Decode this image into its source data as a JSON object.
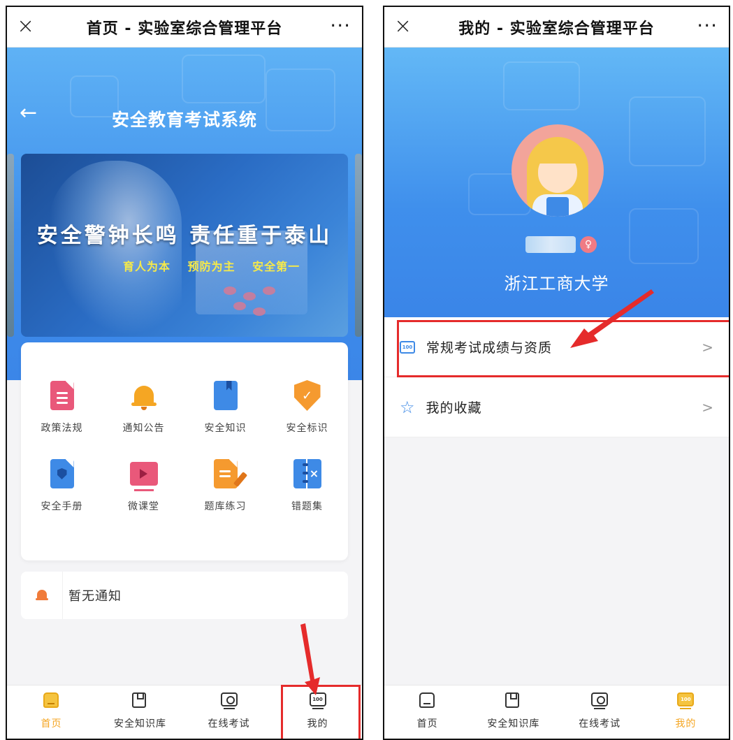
{
  "left_screen": {
    "titlebar": {
      "close": "×",
      "title": "首页 - 实验室综合管理平台",
      "more": "···"
    },
    "hero": {
      "back": "←",
      "title": "安全教育考试系统"
    },
    "banner": {
      "slogan": "安全警钟长鸣  责任重于泰山",
      "subtitle": "育人为本  预防为主  安全第一"
    },
    "menu": [
      {
        "label": "政策法规",
        "icon": "policy-doc-icon"
      },
      {
        "label": "通知公告",
        "icon": "bell-icon"
      },
      {
        "label": "安全知识",
        "icon": "book-icon"
      },
      {
        "label": "安全标识",
        "icon": "shield-check-icon"
      },
      {
        "label": "安全手册",
        "icon": "manual-shield-icon"
      },
      {
        "label": "微课堂",
        "icon": "video-play-icon"
      },
      {
        "label": "题库练习",
        "icon": "exam-edit-icon"
      },
      {
        "label": "错题集",
        "icon": "wrong-notebook-icon"
      }
    ],
    "notice": {
      "text": "暂无通知"
    },
    "tabbar": [
      {
        "label": "首页",
        "active": true
      },
      {
        "label": "安全知识库",
        "active": false
      },
      {
        "label": "在线考试",
        "active": false
      },
      {
        "label": "我的",
        "active": false
      }
    ]
  },
  "right_screen": {
    "titlebar": {
      "close": "×",
      "title": "我的 - 实验室综合管理平台",
      "more": "···"
    },
    "profile": {
      "gender_badge": "♀",
      "school": "浙江工商大学"
    },
    "list": [
      {
        "label": "常规考试成绩与资质",
        "icon": "score-100-icon",
        "chevron": ">"
      },
      {
        "label": "我的收藏",
        "icon": "star-icon",
        "chevron": ">"
      }
    ],
    "tabbar": [
      {
        "label": "首页",
        "active": false
      },
      {
        "label": "安全知识库",
        "active": false
      },
      {
        "label": "在线考试",
        "active": false
      },
      {
        "label": "我的",
        "active": true
      }
    ]
  },
  "icon_text": {
    "score": "100"
  },
  "colors": {
    "accent_blue": "#3e8ae6",
    "active_tab": "#f5a623",
    "annotation_red": "#e52b2b",
    "pink": "#e9587a",
    "orange": "#f59a2f"
  }
}
